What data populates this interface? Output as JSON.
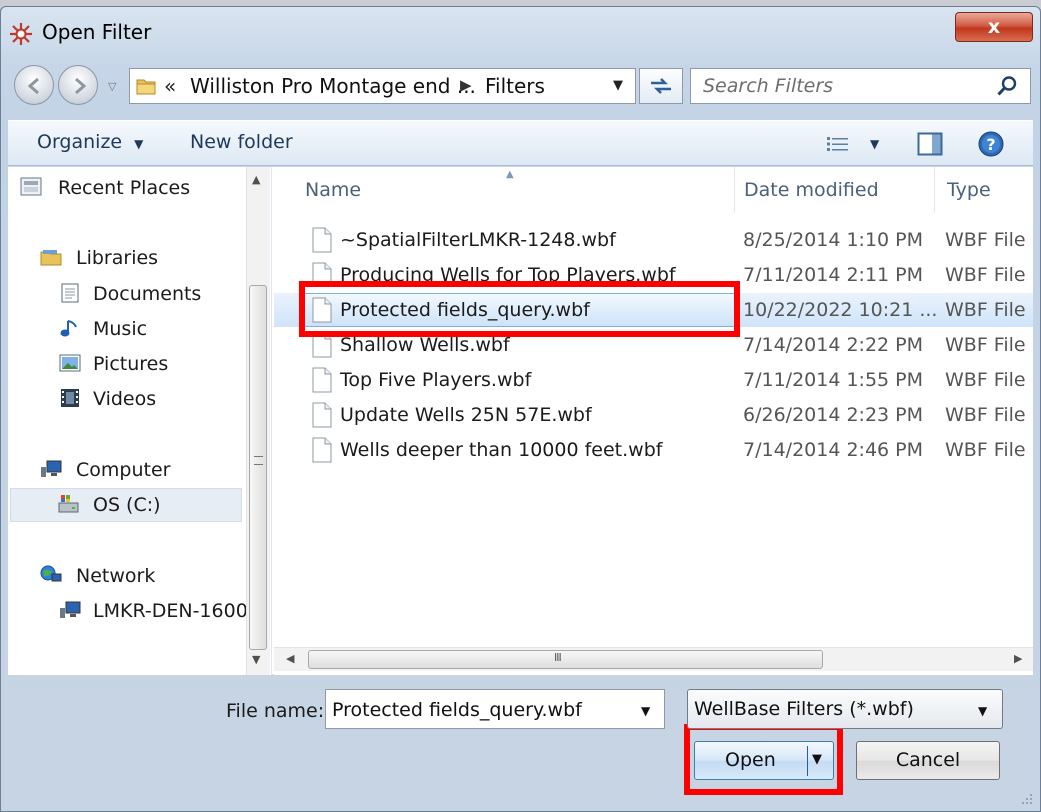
{
  "window": {
    "title": "Open Filter",
    "close_label": "x"
  },
  "address": {
    "chevrons": "«",
    "segments": [
      "Williston Pro Montage end ...",
      "Filters"
    ]
  },
  "search": {
    "placeholder": "Search Filters"
  },
  "toolbar": {
    "organize": "Organize",
    "new_folder": "New folder"
  },
  "nav": {
    "items": [
      {
        "label": "Recent Places",
        "icon": "recent-places-icon"
      },
      {
        "label": "Libraries",
        "icon": "libraries-icon"
      },
      {
        "label": "Documents",
        "icon": "documents-icon"
      },
      {
        "label": "Music",
        "icon": "music-icon"
      },
      {
        "label": "Pictures",
        "icon": "pictures-icon"
      },
      {
        "label": "Videos",
        "icon": "videos-icon"
      },
      {
        "label": "Computer",
        "icon": "computer-icon"
      },
      {
        "label": "OS (C:)",
        "icon": "drive-icon"
      },
      {
        "label": "Network",
        "icon": "network-icon"
      },
      {
        "label": "LMKR-DEN-1600",
        "icon": "network-pc-icon"
      }
    ],
    "selected": "OS (C:)"
  },
  "columns": {
    "name": "Name",
    "date": "Date modified",
    "type": "Type"
  },
  "files": [
    {
      "name": "~SpatialFilterLMKR-1248.wbf",
      "date": "8/25/2014 1:10 PM",
      "type": "WBF File"
    },
    {
      "name": "Producing Wells for Top Players.wbf",
      "date": "7/11/2014 2:11 PM",
      "type": "WBF File"
    },
    {
      "name": "Protected fields_query.wbf",
      "date": "10/22/2022 10:21 ...",
      "type": "WBF File"
    },
    {
      "name": "Shallow Wells.wbf",
      "date": "7/14/2014 2:22 PM",
      "type": "WBF File"
    },
    {
      "name": "Top Five Players.wbf",
      "date": "7/11/2014 1:55 PM",
      "type": "WBF File"
    },
    {
      "name": "Update Wells 25N 57E.wbf",
      "date": "6/26/2014 2:23 PM",
      "type": "WBF File"
    },
    {
      "name": "Wells deeper than 10000 feet.wbf",
      "date": "7/14/2014 2:46 PM",
      "type": "WBF File"
    }
  ],
  "selected_file": "Protected fields_query.wbf",
  "hscroll_grip": "III",
  "bottom": {
    "file_name_label": "File name:",
    "file_name_value": "Protected fields_query.wbf",
    "file_type_value": "WellBase Filters (*.wbf)",
    "open": "Open",
    "cancel": "Cancel"
  },
  "colors": {
    "highlight": "#ff0000",
    "selection": "#cde3f9",
    "close": "#c1361d"
  }
}
